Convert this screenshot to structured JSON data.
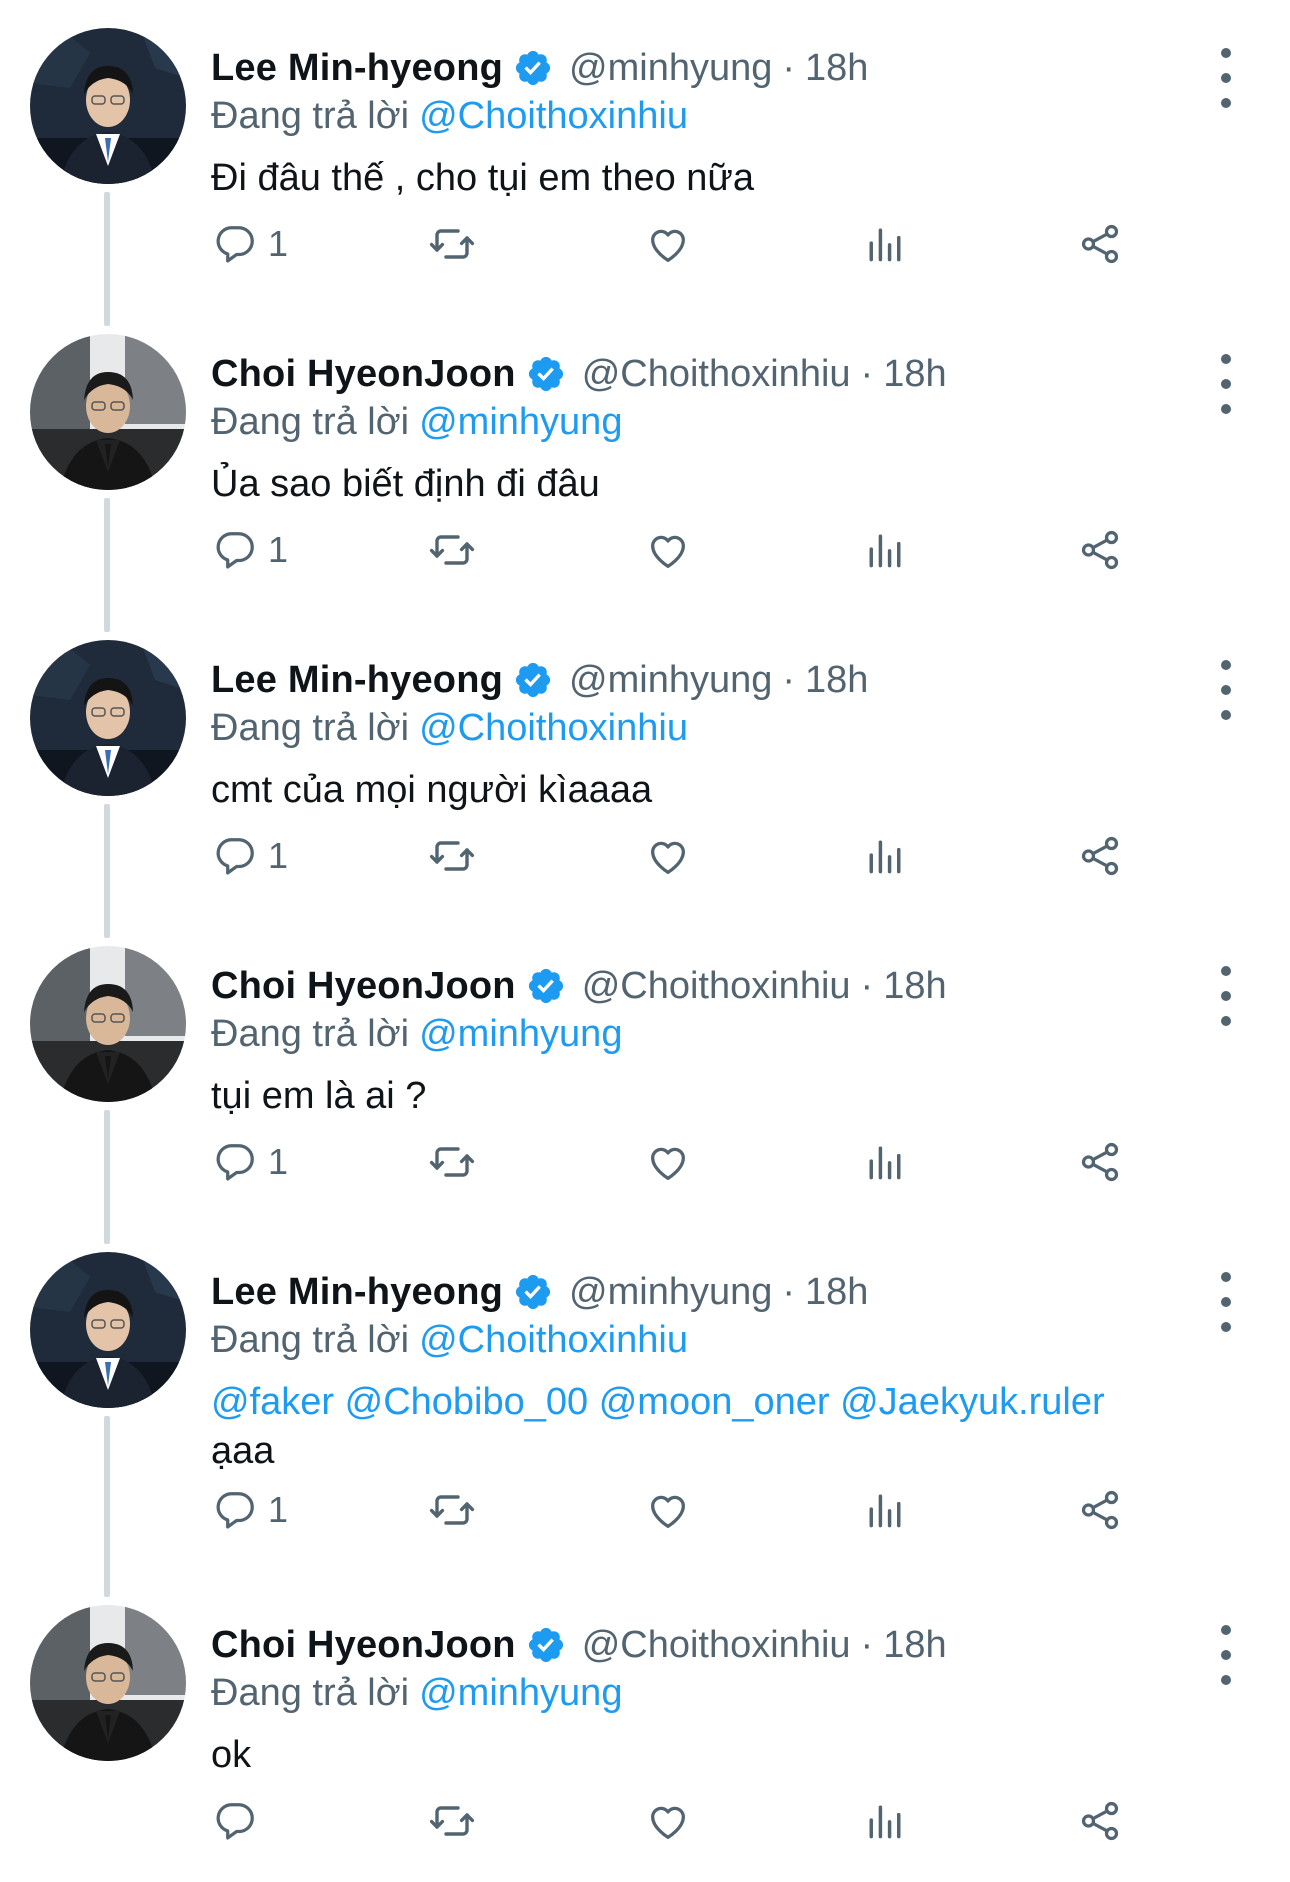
{
  "thread": {
    "replying_prefix": "Đang trả lời",
    "tweets": [
      {
        "name": "Lee Min-hyeong",
        "handle": "@minhyung",
        "separator": "·",
        "time": "18h",
        "replying_to": "@Choithoxinhiu",
        "text": "Đi đâu thế , cho tụi em theo nữa",
        "reply_count": "1"
      },
      {
        "name": "Choi HyeonJoon",
        "handle": "@Choithoxinhiu",
        "separator": "·",
        "time": "18h",
        "replying_to": "@minhyung",
        "text": "Ủa sao biết định đi đâu",
        "reply_count": "1"
      },
      {
        "name": "Lee Min-hyeong",
        "handle": "@minhyung",
        "separator": "·",
        "time": "18h",
        "replying_to": "@Choithoxinhiu",
        "text": "cmt của mọi người kìaaaa",
        "reply_count": "1"
      },
      {
        "name": "Choi HyeonJoon",
        "handle": "@Choithoxinhiu",
        "separator": "·",
        "time": "18h",
        "replying_to": "@minhyung",
        "text": "tụi em là ai ?",
        "reply_count": "1"
      },
      {
        "name": "Lee Min-hyeong",
        "handle": "@minhyung",
        "separator": "·",
        "time": "18h",
        "replying_to": "@Choithoxinhiu",
        "mentions": [
          "@faker",
          "@Chobibo_00",
          "@moon_oner",
          "@Jaekyuk.ruler"
        ],
        "text": "ạaa",
        "reply_count": "1"
      },
      {
        "name": "Choi HyeonJoon",
        "handle": "@Choithoxinhiu",
        "separator": "·",
        "time": "18h",
        "replying_to": "@minhyung",
        "text": "ok",
        "reply_count": ""
      }
    ]
  },
  "colors": {
    "name": "#0f1419",
    "secondary": "#536471",
    "link": "#1d9bf0",
    "thread_line": "#cfd9de"
  },
  "icons": {
    "verified": "verified-badge-icon",
    "more": "more-vertical-icon",
    "reply": "reply-icon",
    "retweet": "retweet-icon",
    "like": "heart-icon",
    "views": "views-chart-icon",
    "share": "share-icon"
  }
}
